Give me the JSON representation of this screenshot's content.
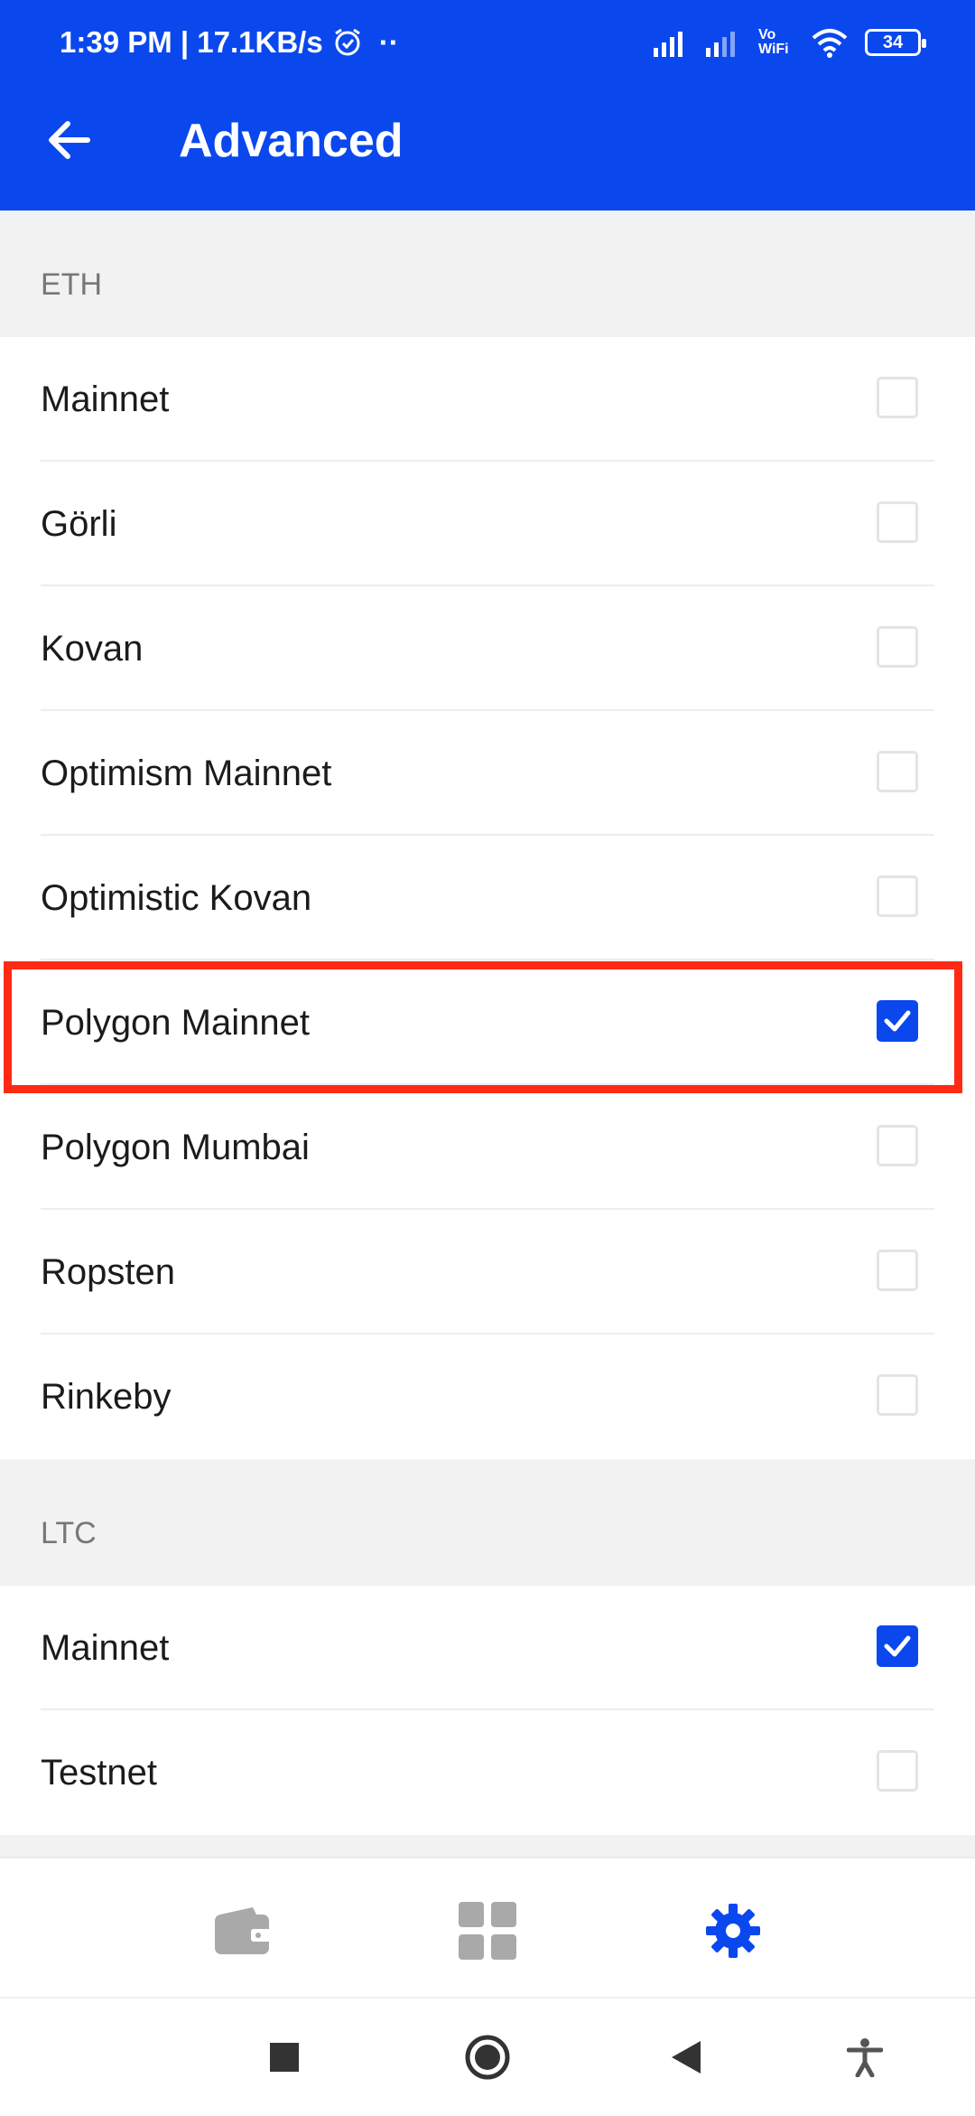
{
  "status_bar": {
    "time_speed": "1:39 PM | 17.1KB/s",
    "dots": "··",
    "vowifi": "Vo WiFi",
    "battery": "34"
  },
  "app_bar": {
    "title": "Advanced",
    "back_icon": "arrow-left-icon"
  },
  "sections": [
    {
      "header": "ETH",
      "items": [
        {
          "label": "Mainnet",
          "checked": false
        },
        {
          "label": "Görli",
          "checked": false
        },
        {
          "label": "Kovan",
          "checked": false
        },
        {
          "label": "Optimism Mainnet",
          "checked": false
        },
        {
          "label": "Optimistic Kovan",
          "checked": false
        },
        {
          "label": "Polygon Mainnet",
          "checked": true
        },
        {
          "label": "Polygon Mumbai",
          "checked": false
        },
        {
          "label": "Ropsten",
          "checked": false
        },
        {
          "label": "Rinkeby",
          "checked": false
        }
      ]
    },
    {
      "header": "LTC",
      "items": [
        {
          "label": "Mainnet",
          "checked": true
        },
        {
          "label": "Testnet",
          "checked": false
        }
      ]
    }
  ],
  "bottom_nav": [
    {
      "icon": "wallet-icon",
      "active": false
    },
    {
      "icon": "apps-grid-icon",
      "active": false
    },
    {
      "icon": "settings-gear-icon",
      "active": true
    }
  ],
  "colors": {
    "primary": "#0a48ee",
    "highlight": "#ff2a14",
    "inactive_icon": "#a9a9a9"
  }
}
